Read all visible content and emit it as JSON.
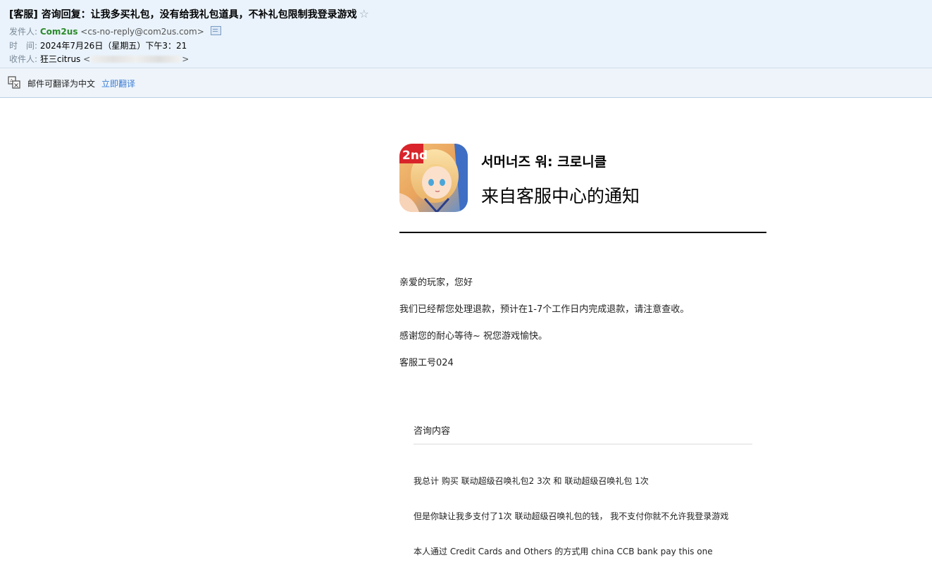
{
  "header": {
    "subject": "[客服] 咨询回复：让我多买礼包，没有给我礼包道具，不补礼包限制我登录游戏",
    "star": "☆",
    "from_label": "发件人:",
    "from_name": "Com2us",
    "from_address": "<cs-no-reply@com2us.com>",
    "time_label": "时　间:",
    "time_value": "2024年7月26日（星期五）下午3：21",
    "to_label": "收件人:",
    "to_name": "狂三citrus",
    "to_open": "<",
    "to_close": ">"
  },
  "translate": {
    "text": "邮件可翻译为中文",
    "link": "立即翻译"
  },
  "email": {
    "game_title": "서머너즈 워: 크로니클",
    "notice_title": "来自客服中心的通知",
    "greeting": "亲爱的玩家，您好",
    "line1": "我们已经帮您处理退款，预计在1-7个工作日内完成退款，请注意查收。",
    "line2": "感谢您的耐心等待~ 祝您游戏愉快。",
    "signature": "客服工号024",
    "inquiry_title": "咨询内容",
    "inquiry_lines": [
      "我总计 购买 联动超级召唤礼包2 3次 和 联动超级召唤礼包 1次",
      "但是你缺让我多支付了1次 联动超级召唤礼包的钱， 我不支付你就不允许我登录游戏",
      "本人通过 Credit Cards and Others 的方式用 china CCB bank pay this one"
    ],
    "icon_badge": "2nd"
  },
  "colors": {
    "header_bg": "#eaf3fb",
    "sender": "#2c8a2c",
    "link": "#3a7bd5"
  }
}
